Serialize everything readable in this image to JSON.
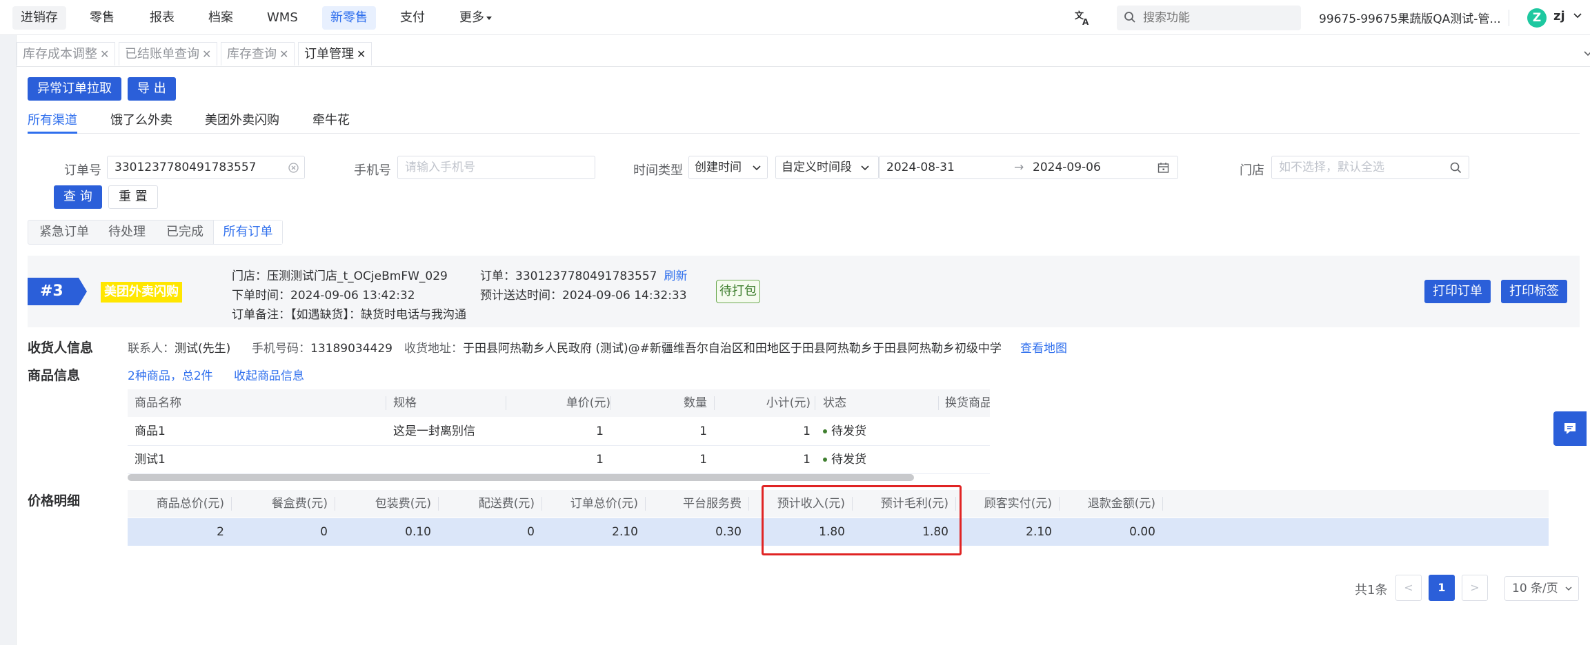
{
  "nav": {
    "items": [
      {
        "label": "进销存",
        "state": "gray"
      },
      {
        "label": "零售",
        "state": ""
      },
      {
        "label": "报表",
        "state": ""
      },
      {
        "label": "档案",
        "state": ""
      },
      {
        "label": "WMS",
        "state": ""
      },
      {
        "label": "新零售",
        "state": "active"
      },
      {
        "label": "支付",
        "state": ""
      },
      {
        "label": "更多",
        "state": ""
      }
    ],
    "search_placeholder": "搜索功能",
    "account": "99675-99675果蔬版QA测试-管...",
    "avatar_letter": "Z",
    "user": "zj"
  },
  "tabs": [
    {
      "label": "库存成本调整"
    },
    {
      "label": "已结账单查询"
    },
    {
      "label": "库存查询"
    },
    {
      "label": "订单管理"
    }
  ],
  "actions": {
    "pull_abnormal": "异常订单拉取",
    "export": "导 出"
  },
  "channels": [
    "所有渠道",
    "饿了么外卖",
    "美团外卖闪购",
    "牵牛花"
  ],
  "filters": {
    "order_no_label": "订单号",
    "order_no_value": "3301237780491783557",
    "phone_label": "手机号",
    "phone_placeholder": "请输入手机号",
    "time_type_label": "时间类型",
    "time_type_value": "创建时间",
    "time_range_value": "自定义时间段",
    "date_start": "2024-08-31",
    "date_end": "2024-09-06",
    "store_label": "门店",
    "store_placeholder": "如不选择，默认全选",
    "query": "查 询",
    "reset": "重 置"
  },
  "status_tabs": [
    "紧急订单",
    "待处理",
    "已完成",
    "所有订单"
  ],
  "order": {
    "seq": "#3",
    "channel": "美团外卖闪购",
    "store_label": "门店：",
    "store": "压测测试门店_t_OCjeBmFW_029",
    "placed_label": "下单时间：",
    "placed": "2024-09-06 13:42:32",
    "remark_label": "订单备注：",
    "remark": "【如遇缺货】：缺货时电话与我沟通",
    "order_label": "订单：",
    "order_no": "3301237780491783557",
    "refresh": "刷新",
    "eta_label": "预计送达时间：",
    "eta": "2024-09-06 14:32:33",
    "status": "待打包",
    "print_order": "打印订单",
    "print_label": "打印标签"
  },
  "receiver": {
    "title": "收货人信息",
    "contact_label": "联系人：",
    "contact": "测试(先生)",
    "phone_label": "手机号码：",
    "phone": "13189034429",
    "address_label": "收货地址：",
    "address": "于田县阿热勒乡人民政府 (测试)@#新疆维吾尔自治区和田地区于田县阿热勒乡于田县阿热勒乡初级中学",
    "map_link": "查看地图"
  },
  "goods": {
    "title": "商品信息",
    "summary": "2种商品，总2件",
    "collapse": "收起商品信息",
    "headers": [
      "商品名称",
      "规格",
      "单价(元)",
      "数量",
      "小计(元)",
      "状态",
      "换货商品"
    ],
    "rows": [
      {
        "name": "商品1",
        "spec": "这是一封离别信",
        "price": "1",
        "qty": "1",
        "subtotal": "1",
        "status": "待发货"
      },
      {
        "name": "测试1",
        "spec": "",
        "price": "1",
        "qty": "1",
        "subtotal": "1",
        "status": "待发货"
      }
    ]
  },
  "price": {
    "title": "价格明细",
    "headers": [
      "商品总价(元)",
      "餐盒费(元)",
      "包装费(元)",
      "配送费(元)",
      "订单总价(元)",
      "平台服务费",
      "预计收入(元)",
      "预计毛利(元)",
      "顾客实付(元)",
      "退款金额(元)"
    ],
    "values": [
      "2",
      "0",
      "0.10",
      "0",
      "2.10",
      "0.30",
      "1.80",
      "1.80",
      "2.10",
      "0.00"
    ]
  },
  "pagination": {
    "total": "共1条",
    "prev": "<",
    "page": "1",
    "next": ">",
    "size": "10 条/页"
  }
}
